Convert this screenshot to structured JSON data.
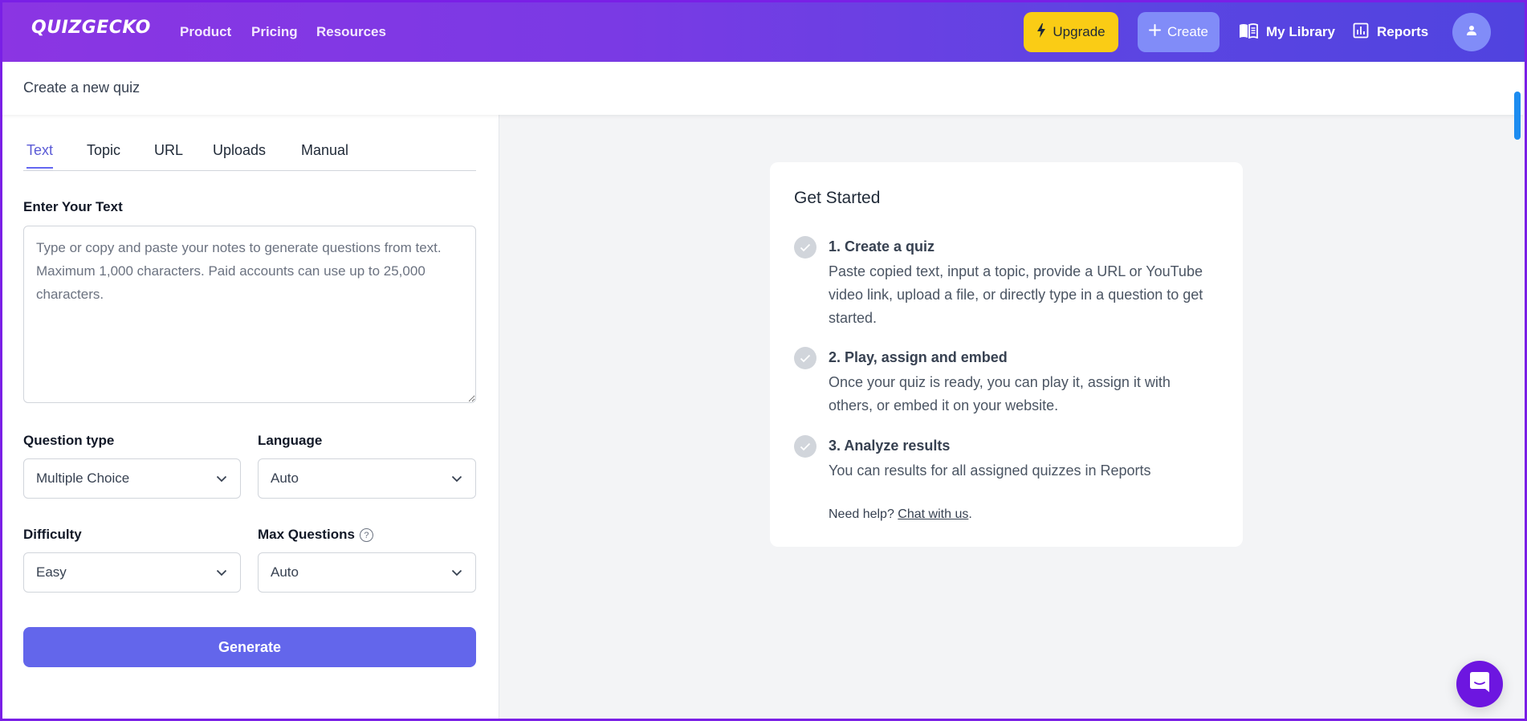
{
  "header": {
    "logo": "QUIZGECKO",
    "nav": [
      "Product",
      "Pricing",
      "Resources"
    ],
    "upgrade_label": "Upgrade",
    "create_label": "Create",
    "library_label": "My Library",
    "reports_label": "Reports",
    "icons": {
      "upgrade": "lightning-bolt-icon",
      "create": "plus-icon",
      "library": "book-icon",
      "reports": "bar-chart-icon",
      "avatar": "user-icon"
    }
  },
  "subheader": {
    "title": "Create a new quiz"
  },
  "form": {
    "tabs": [
      {
        "label": "Text",
        "active": true
      },
      {
        "label": "Topic",
        "active": false
      },
      {
        "label": "URL",
        "active": false
      },
      {
        "label": "Uploads",
        "active": false
      },
      {
        "label": "Manual",
        "active": false
      }
    ],
    "text_label": "Enter Your Text",
    "text_value": "",
    "text_placeholder": "Type or copy and paste your notes to generate questions from text. Maximum 1,000 characters. Paid accounts can use up to 25,000 characters.",
    "question_type": {
      "label": "Question type",
      "value": "Multiple Choice"
    },
    "language": {
      "label": "Language",
      "value": "Auto"
    },
    "difficulty": {
      "label": "Difficulty",
      "value": "Easy"
    },
    "max_questions": {
      "label": "Max Questions",
      "value": "Auto",
      "help": "?"
    },
    "generate_label": "Generate"
  },
  "get_started": {
    "title": "Get Started",
    "steps": [
      {
        "title": "1. Create a quiz",
        "text": "Paste copied text, input a topic, provide a URL or YouTube video link, upload a file, or directly type in a question to get started."
      },
      {
        "title": "2. Play, assign and embed",
        "text": "Once your quiz is ready, you can play it, assign it with others, or embed it on your website."
      },
      {
        "title": "3. Analyze results",
        "text": "You can results for all assigned quizzes in Reports"
      }
    ],
    "help_prefix": "Need help? ",
    "help_link": "Chat with us",
    "help_suffix": "."
  },
  "colors": {
    "brand_purple": "#7a1fe6",
    "upgrade_yellow": "#facc15",
    "create_blue": "#818cf8",
    "generate_indigo": "#6366eb",
    "tab_active": "#5b5bd6",
    "chat_fab": "#6d16e0"
  }
}
